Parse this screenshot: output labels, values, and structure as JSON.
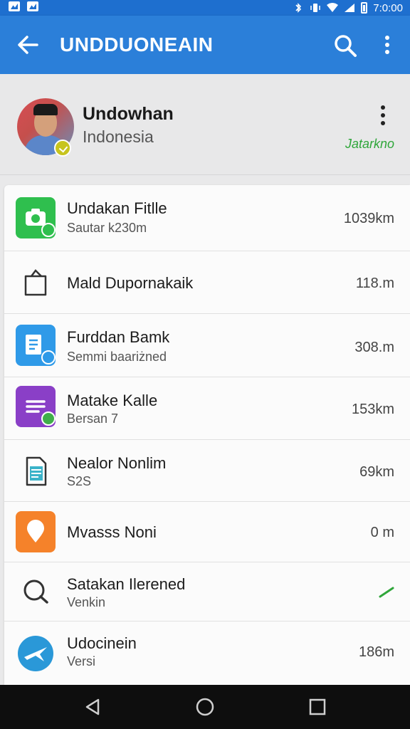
{
  "status_bar": {
    "time": "7:0:00"
  },
  "app_bar": {
    "title": "UNDDUONEAIN"
  },
  "profile": {
    "name": "Undowhan",
    "country": "Indonesia",
    "status": "Jatarkno"
  },
  "items": [
    {
      "title": "Undakan Fitlle",
      "subtitle": "Sautar k230m",
      "value": "1039km",
      "icon": "green-camera-icon"
    },
    {
      "title": "Mald Dupornakaik",
      "subtitle": "",
      "value": "118.m",
      "icon": "bag-icon"
    },
    {
      "title": "Furddan Bamk",
      "subtitle": "Semmi baariżned",
      "value": "308.m",
      "icon": "blue-document-icon"
    },
    {
      "title": "Matake Kalle",
      "subtitle": "Bersan 7",
      "value": "153km",
      "icon": "purple-list-icon"
    },
    {
      "title": "Nealor Nonlim",
      "subtitle": "S2S",
      "value": "69km",
      "icon": "document-icon"
    },
    {
      "title": "Mvasss Noni",
      "subtitle": "",
      "value": "0 m",
      "icon": "orange-location-icon"
    },
    {
      "title": "Satakan Ilerened",
      "subtitle": "Venkin",
      "value": "",
      "icon": "search-icon"
    },
    {
      "title": "Udocinein",
      "subtitle": "Versi",
      "value": "186m",
      "icon": "blue-plane-icon"
    }
  ],
  "colors": {
    "appbar": "#2b7fd9",
    "accent_green": "#2fa63a"
  }
}
